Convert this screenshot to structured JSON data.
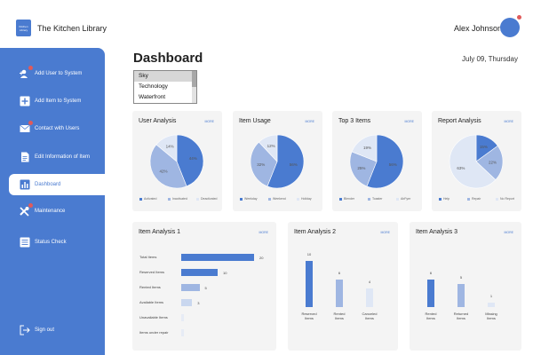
{
  "app": {
    "title": "The Kitchen Library",
    "logo_text": "Kitchen Library"
  },
  "user": {
    "name": "Alex Johnson"
  },
  "sidebar": {
    "items": [
      {
        "label": "Add User to System",
        "icon": "add-user-icon"
      },
      {
        "label": "Add Item to System",
        "icon": "add-item-icon"
      },
      {
        "label": "Contact with Users",
        "icon": "mail-icon"
      },
      {
        "label": "Edit Information of Item",
        "icon": "document-icon"
      },
      {
        "label": "Dashboard",
        "icon": "bar-chart-icon"
      },
      {
        "label": "Maintenance",
        "icon": "wrench-icon"
      },
      {
        "label": "Status Check",
        "icon": "checklist-icon"
      },
      {
        "label": "Sign out",
        "icon": "sign-out-icon"
      }
    ]
  },
  "header": {
    "title": "Dashboard",
    "date": "July 09, Thursday"
  },
  "location_list": {
    "options": [
      "Sky",
      "Technology",
      "Waterfront"
    ],
    "selected": "Sky"
  },
  "more_label": "MORE",
  "colors": {
    "primary": "#4a7bd0",
    "mid": "#9fb6e2",
    "light": "#dfe7f5",
    "notification": "#e05a5a"
  },
  "chart_data": [
    {
      "type": "pie",
      "title": "User Analysis",
      "series": [
        {
          "name": "Activated",
          "value": 44
        },
        {
          "name": "Inactivated",
          "value": 42
        },
        {
          "name": "Deactivated",
          "value": 14
        }
      ]
    },
    {
      "type": "pie",
      "title": "Item Usage",
      "series": [
        {
          "name": "Weekday",
          "value": 56
        },
        {
          "name": "Weekend",
          "value": 32
        },
        {
          "name": "Holiday",
          "value": 12
        }
      ]
    },
    {
      "type": "pie",
      "title": "Top 3 Items",
      "series": [
        {
          "name": "Blender",
          "value": 56
        },
        {
          "name": "Toaster",
          "value": 25
        },
        {
          "name": "AirFyer",
          "value": 19
        }
      ]
    },
    {
      "type": "pie",
      "title": "Report Analysis",
      "series": [
        {
          "name": "Help",
          "value": 15
        },
        {
          "name": "Repair",
          "value": 22
        },
        {
          "name": "No Report",
          "value": 63
        }
      ]
    },
    {
      "type": "bar",
      "orientation": "horizontal",
      "title": "Item Analysis 1",
      "categories": [
        "Total Items",
        "Reserved Items",
        "Rented Items",
        "Available Items",
        "Unavailable Items",
        "Items under repair"
      ],
      "values": [
        20,
        10,
        5,
        3,
        null,
        null
      ]
    },
    {
      "type": "bar",
      "title": "Item Analysis 2",
      "categories": [
        "Reserved Items",
        "Rented Items",
        "Canceled Items"
      ],
      "values": [
        10,
        6,
        4
      ]
    },
    {
      "type": "bar",
      "title": "Item Analysis 3",
      "categories": [
        "Rented Items",
        "Returned Items",
        "Missing Items"
      ],
      "values": [
        6,
        5,
        1
      ]
    }
  ]
}
